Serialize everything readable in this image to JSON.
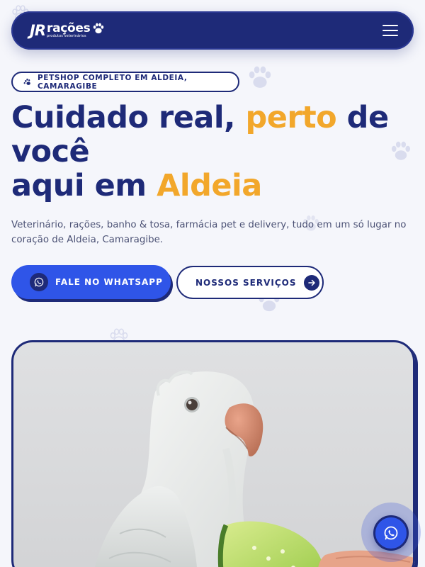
{
  "brand": {
    "logo_mark": "JR",
    "logo_name": "rações",
    "logo_tagline": "produtos veterinários",
    "primary_color": "#1e2a78",
    "accent_color": "#f2a72b",
    "button_blue": "#2f55e8"
  },
  "header": {
    "menu_icon": "hamburger-menu-icon"
  },
  "hero": {
    "badge_icon": "paw-icon",
    "badge_text": "PETSHOP COMPLETO EM ALDEIA, CAMARAGIBE",
    "headline": {
      "part1": "Cuidado real, ",
      "highlight1": "perto",
      "part2": " de você",
      "part3": "aqui em ",
      "highlight2": "Aldeia"
    },
    "description": "Veterinário, rações, banho & tosa, farmácia pet e delivery, tudo em um só lugar no coração de Aldeia, Camaragibe.",
    "whatsapp_button": "FALE NO WHATSAPP",
    "whatsapp_icon": "whatsapp-icon",
    "services_button": "NOSSOS SERVIÇOS",
    "services_icon": "arrow-right-icon",
    "image_subject": "parrot-photo"
  },
  "floating": {
    "whatsapp_icon": "whatsapp-icon"
  }
}
